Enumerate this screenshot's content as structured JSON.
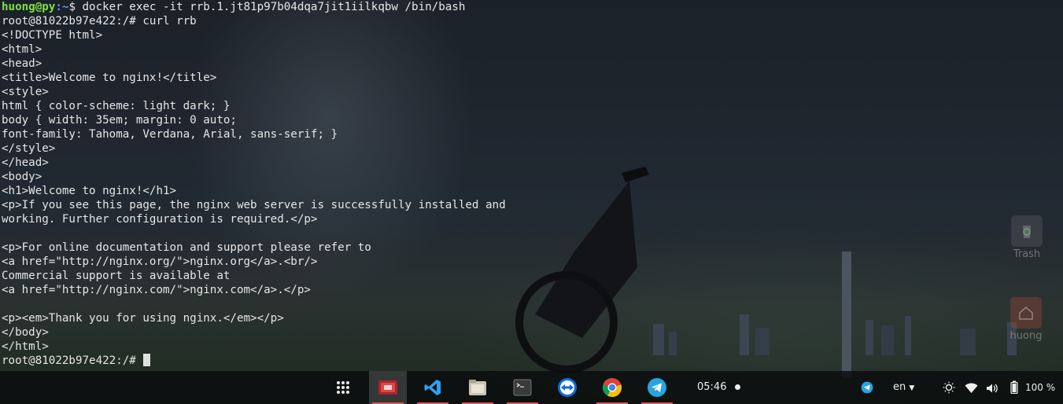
{
  "terminal": {
    "prompt1_user": "huong@py",
    "prompt1_path": ":~",
    "prompt1_cmd": "$ docker exec -it rrb.1.jt81p97b04dqa7jit1iilkqbw /bin/bash",
    "lines": [
      "root@81022b97e422:/# curl rrb",
      "<!DOCTYPE html>",
      "<html>",
      "<head>",
      "<title>Welcome to nginx!</title>",
      "<style>",
      "html { color-scheme: light dark; }",
      "body { width: 35em; margin: 0 auto;",
      "font-family: Tahoma, Verdana, Arial, sans-serif; }",
      "</style>",
      "</head>",
      "<body>",
      "<h1>Welcome to nginx!</h1>",
      "<p>If you see this page, the nginx web server is successfully installed and",
      "working. Further configuration is required.</p>",
      "",
      "<p>For online documentation and support please refer to",
      "<a href=\"http://nginx.org/\">nginx.org</a>.<br/>",
      "Commercial support is available at",
      "<a href=\"http://nginx.com/\">nginx.com</a>.</p>",
      "",
      "<p><em>Thank you for using nginx.</em></p>",
      "</body>",
      "</html>"
    ],
    "final_prompt": "root@81022b97e422:/# "
  },
  "desktop": {
    "trash_label": "Trash",
    "home_label": "huong"
  },
  "taskbar": {
    "apps": [
      "app-grid-icon",
      "screen-recorder-icon",
      "vscode-icon",
      "files-icon",
      "terminal-icon",
      "teamviewer-icon",
      "chrome-icon",
      "telegram-icon"
    ],
    "clock": "05:46",
    "language": "en",
    "battery": "100 %"
  },
  "colors": {
    "prompt_user": "#7ee243",
    "prompt_path": "#6f95d8",
    "terminal_text": "#e6e6e6",
    "active_underline": "#e05555"
  }
}
